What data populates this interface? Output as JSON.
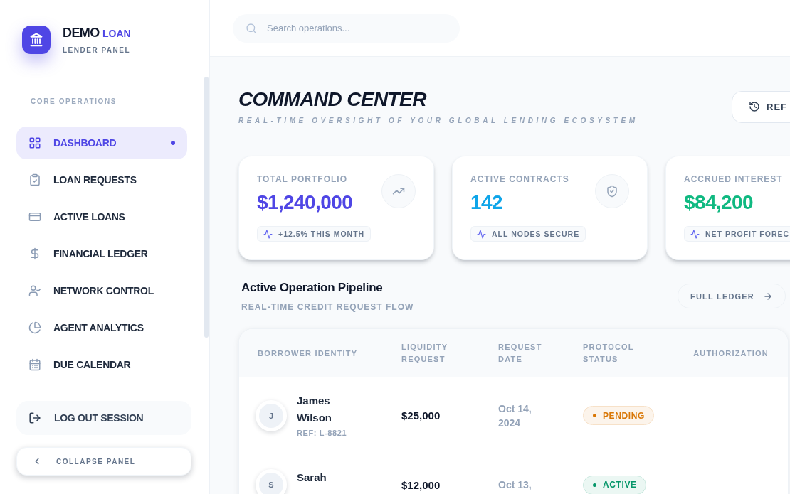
{
  "sidebar": {
    "brand": {
      "name": "DEMO",
      "accent": "LOAN",
      "subtitle": "LENDER PANEL"
    },
    "section_label": "CORE OPERATIONS",
    "items": [
      {
        "label": "DASHBOARD",
        "selected": true
      },
      {
        "label": "LOAN REQUESTS",
        "selected": false
      },
      {
        "label": "ACTIVE LOANS",
        "selected": false
      },
      {
        "label": "FINANCIAL LEDGER",
        "selected": false
      },
      {
        "label": "NETWORK CONTROL",
        "selected": false
      },
      {
        "label": "AGENT ANALYTICS",
        "selected": false
      },
      {
        "label": "DUE CALENDAR",
        "selected": false
      }
    ],
    "logout_button": "LOG OUT SESSION",
    "collapse_button": "COLLAPSE PANEL"
  },
  "header": {
    "search": {
      "placeholder": "Search operations..."
    }
  },
  "page": {
    "title": "COMMAND CENTER",
    "subtitle": "REAL-TIME OVERSIGHT OF YOUR GLOBAL LENDING ECOSYSTEM",
    "refresh_button": "REF"
  },
  "stats": [
    {
      "label": "TOTAL PORTFOLIO",
      "value": "$1,240,000",
      "color": "#4f46e5",
      "note": "+12.5% THIS MONTH"
    },
    {
      "label": "ACTIVE CONTRACTS",
      "value": "142",
      "color": "#0ea5e9",
      "note": "ALL NODES SECURE"
    },
    {
      "label": "ACCRUED INTEREST",
      "value": "$84,200",
      "color": "#10b981",
      "note": "NET PROFIT FOREC"
    }
  ],
  "pipeline": {
    "title": "Active Operation Pipeline",
    "subtitle": "REAL-TIME CREDIT REQUEST FLOW",
    "ledger_button": "FULL LEDGER",
    "table": {
      "columns": [
        "BORROWER IDENTITY",
        "LIQUIDITY REQUEST",
        "REQUEST DATE",
        "PROTOCOL STATUS",
        "AUTHORIZATION"
      ],
      "rows": [
        {
          "initial": "J",
          "name": "James Wilson",
          "ref": "REF: L-8821",
          "amount": "$25,000",
          "date": "Oct 14, 2024",
          "status": {
            "label": "PENDING",
            "color": "#d97706"
          }
        },
        {
          "initial": "S",
          "name": "Sarah",
          "amount": "$12,000",
          "date": "Oct 13,",
          "status": {
            "label": "ACTIVE",
            "color": "#059669"
          }
        }
      ]
    }
  }
}
